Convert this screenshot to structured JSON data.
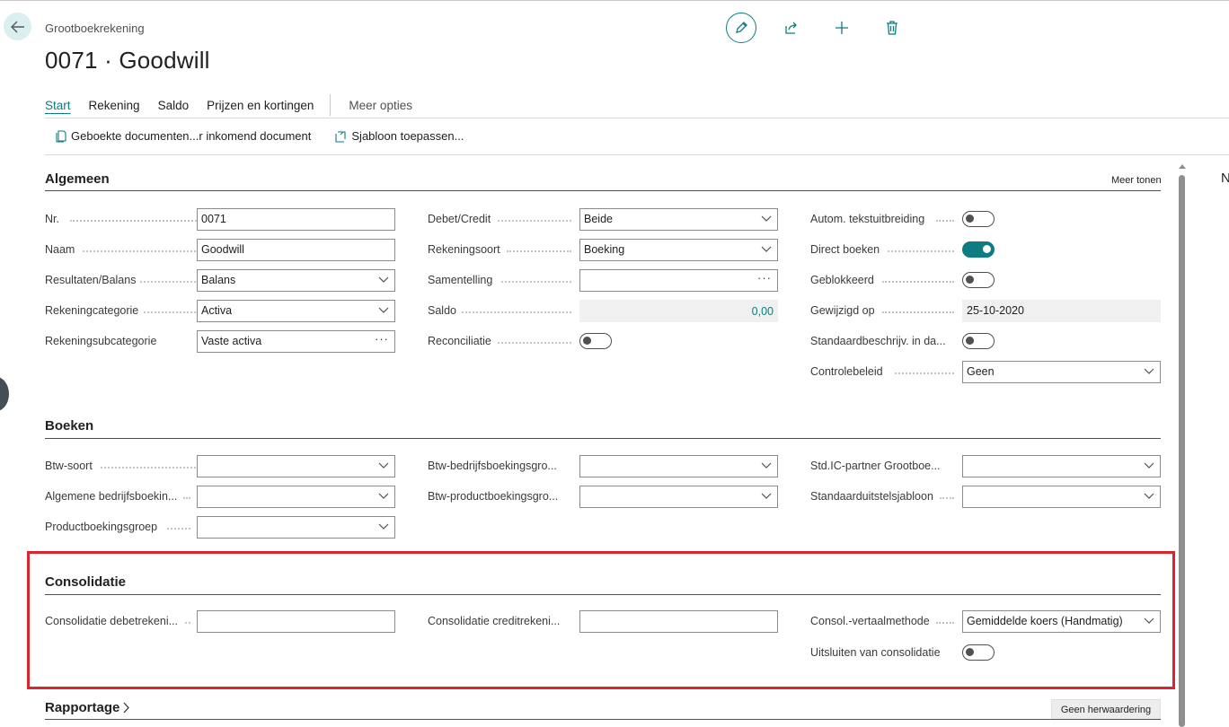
{
  "header": {
    "breadcrumb": "Grootboekrekening",
    "title": "0071 · Goodwill"
  },
  "tabs": [
    {
      "label": "Start",
      "active": true
    },
    {
      "label": "Rekening"
    },
    {
      "label": "Saldo"
    },
    {
      "label": "Prijzen en kortingen"
    },
    {
      "label": "Meer opties"
    }
  ],
  "toolbar": {
    "item1": "Geboekte documenten...r inkomend document",
    "item2": "Sjabloon toepassen..."
  },
  "colors": {
    "accent": "#0f7b83",
    "highlight_border": "#d9262d"
  },
  "algemeen": {
    "title": "Algemeen",
    "meer_tonen": "Meer tonen",
    "col1": [
      {
        "label": "Nr.",
        "value": "0071",
        "type": "text"
      },
      {
        "label": "Naam",
        "value": "Goodwill",
        "type": "text"
      },
      {
        "label": "Resultaten/Balans",
        "value": "Balans",
        "type": "select"
      },
      {
        "label": "Rekeningcategorie",
        "value": "Activa",
        "type": "select"
      },
      {
        "label": "Rekeningsubcategorie",
        "value": "Vaste activa",
        "type": "lookup"
      }
    ],
    "col2": [
      {
        "label": "Debet/Credit",
        "value": "Beide",
        "type": "select"
      },
      {
        "label": "Rekeningsoort",
        "value": "Boeking",
        "type": "select"
      },
      {
        "label": "Samentelling",
        "value": "",
        "type": "lookup"
      },
      {
        "label": "Saldo",
        "value": "0,00",
        "type": "readonly-number"
      },
      {
        "label": "Reconciliatie",
        "type": "toggle",
        "on": false
      }
    ],
    "col3": [
      {
        "label": "Autom. tekstuitbreiding",
        "type": "toggle",
        "on": false
      },
      {
        "label": "Direct boeken",
        "type": "toggle",
        "on": true
      },
      {
        "label": "Geblokkeerd",
        "type": "toggle",
        "on": false
      },
      {
        "label": "Gewijzigd op",
        "value": "25-10-2020",
        "type": "readonly"
      },
      {
        "label": "Standaardbeschrijv. in da...",
        "type": "toggle",
        "on": false
      },
      {
        "label": "Controlebeleid",
        "value": "Geen",
        "type": "select"
      }
    ]
  },
  "boeken": {
    "title": "Boeken",
    "col1": [
      {
        "label": "Btw-soort",
        "value": ""
      },
      {
        "label": "Algemene bedrijfsboekin...",
        "value": ""
      },
      {
        "label": "Productboekingsgroep",
        "value": ""
      }
    ],
    "col2": [
      {
        "label": "Btw-bedrijfsboekingsgro...",
        "value": ""
      },
      {
        "label": "Btw-productboekingsgro...",
        "value": ""
      }
    ],
    "col3": [
      {
        "label": "Std.IC-partner Grootboe...",
        "value": ""
      },
      {
        "label": "Standaarduitstelsjabloon",
        "value": ""
      }
    ]
  },
  "consolidatie": {
    "title": "Consolidatie",
    "debet_label": "Consolidatie debetrekeni...",
    "debet_value": "",
    "credit_label": "Consolidatie creditrekeni...",
    "credit_value": "",
    "methode_label": "Consol.-vertaalmethode",
    "methode_value": "Gemiddelde koers (Handmatig)",
    "uitsluiten_label": "Uitsluiten van consolidatie",
    "uitsluiten_on": false
  },
  "rapportage": {
    "title": "Rapportage",
    "button": "Geen herwaardering"
  },
  "side_panel": {
    "letter": "N"
  }
}
